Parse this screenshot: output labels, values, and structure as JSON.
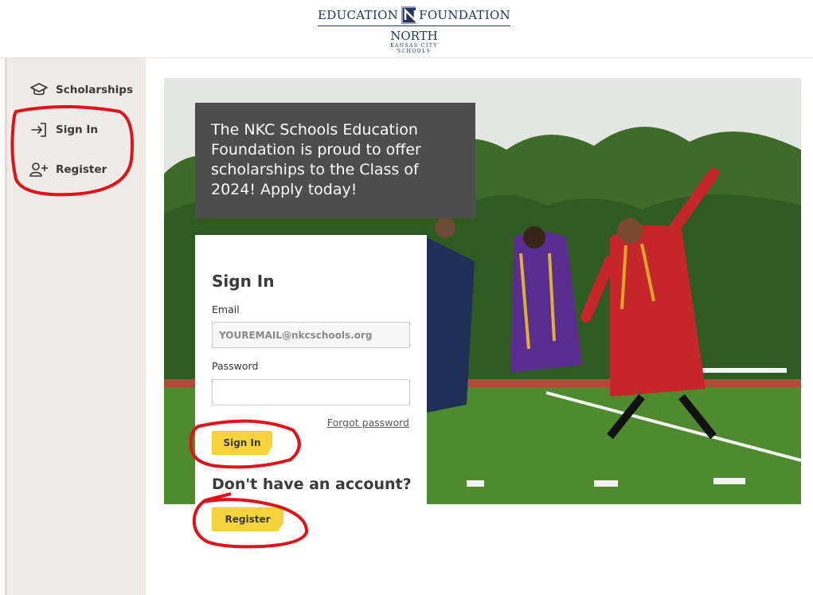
{
  "header": {
    "logo_left": "EDUCATION",
    "logo_right": "FOUNDATION",
    "logo_north": "NORTH",
    "logo_kc": "KANSAS CITY",
    "logo_schools": "SCHOOLS"
  },
  "sidebar": {
    "items": [
      {
        "label": "Scholarships",
        "icon": "graduation-cap-icon"
      },
      {
        "label": "Sign In",
        "icon": "sign-in-arrow-icon"
      },
      {
        "label": "Register",
        "icon": "user-plus-icon"
      }
    ]
  },
  "hero": {
    "promo_text": "The NKC Schools Education Foundation is proud to offer scholarships to the Class of 2024! Apply today!"
  },
  "signin": {
    "title": "Sign In",
    "email_label": "Email",
    "email_placeholder": "YOUREMAIL@nkcschools.org",
    "password_label": "Password",
    "forgot_link": "Forgot password",
    "signin_button": "Sign In",
    "no_account": "Don't have an account?",
    "register_button": "Register"
  },
  "colors": {
    "brand_navy": "#24365e",
    "button_yellow": "#f6d23d",
    "sidebar_bg": "#efebe9",
    "promo_bg": "#4d4d4d",
    "annotation_red": "#e0121a"
  }
}
